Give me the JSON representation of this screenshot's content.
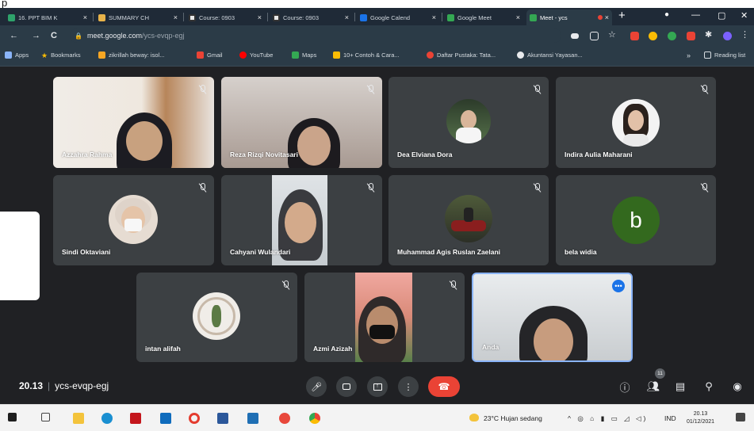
{
  "stray_char": "p",
  "browser": {
    "tabs": [
      {
        "label": "16. PPT BIM K",
        "color": "#2ea36b"
      },
      {
        "label": "SUMMARY CH",
        "color": "#e8b34a"
      },
      {
        "label": "Course: 0903",
        "color": "#333"
      },
      {
        "label": "Course: 0903",
        "color": "#333"
      },
      {
        "label": "Google Calend",
        "color": "#1a73e8"
      },
      {
        "label": "Google Meet",
        "color": "#34a853"
      },
      {
        "label": "Meet - ycs",
        "color": "#34a853"
      }
    ],
    "tab_close": "×",
    "new_tab": "+",
    "window_controls": {
      "minimize": "—",
      "maximize": "▢",
      "close": "✕"
    },
    "nav": {
      "back": "←",
      "forward": "→",
      "reload": "C"
    },
    "url_host": "meet.google.com",
    "url_path": "/ycs-evqp-egj",
    "extension_colors": [
      "#e8eaed",
      "#e8eaed",
      "#e8eaed",
      "#ea4335",
      "#fbbc04",
      "#34a853",
      "#ea4335",
      "#e8eaed",
      "#7b61ff",
      "#e8eaed"
    ],
    "bookmarks": [
      {
        "label": "Apps",
        "color": "#8ab4f8"
      },
      {
        "label": "Bookmarks",
        "color": "#fbbc04"
      },
      {
        "label": "zikrillah beway: isol...",
        "color": "#f6a623"
      },
      {
        "label": "Gmail",
        "color": "#ea4335"
      },
      {
        "label": "YouTube",
        "color": "#ff0000"
      },
      {
        "label": "Maps",
        "color": "#34a853"
      },
      {
        "label": "10+ Contoh & Cara...",
        "color": "#fbbc04"
      },
      {
        "label": "Daftar Pustaka: Tata...",
        "color": "#ea4335"
      },
      {
        "label": "Akuntansi Yayasan...",
        "color": "#e8eaed"
      }
    ],
    "bookmarks_more": "»",
    "reading_list": "Reading list"
  },
  "participants": [
    {
      "name": "Azzahra Rahma",
      "kind": "video",
      "bg": "#8c7b6b"
    },
    {
      "name": "Reza Rizqi Novitasari",
      "kind": "video",
      "bg": "#9d8f87"
    },
    {
      "name": "Dea Elviana Dora",
      "kind": "photo",
      "bg": "#3c4043"
    },
    {
      "name": "Indira Aulia Maharani",
      "kind": "photo",
      "bg": "#3c4043"
    },
    {
      "name": "Sindi Oktaviani",
      "kind": "photo",
      "bg": "#3c4043"
    },
    {
      "name": "Cahyani Wulandari",
      "kind": "video",
      "bg": "#3c4043"
    },
    {
      "name": "Muhammad Agis Ruslan Zaelani",
      "kind": "photo",
      "bg": "#3c4043"
    },
    {
      "name": "bela widia",
      "kind": "letter",
      "letter": "b",
      "bg": "#3c4043"
    },
    {
      "name": "intan alifah",
      "kind": "photo",
      "bg": "#3c4043"
    },
    {
      "name": "Azmi Azizah",
      "kind": "video",
      "bg": "#3c4043"
    },
    {
      "name": "Anda",
      "kind": "self",
      "bg": "#cfd3d6"
    }
  ],
  "controls": {
    "time": "20.13",
    "meeting_code": "ycs-evqp-egj",
    "participant_count": "11"
  },
  "taskbar": {
    "weather": "23°C  Hujan sedang",
    "lang": "IND",
    "clock_time": "20.13",
    "clock_date": "01/12/2021"
  },
  "colors": {
    "stage_bg": "#202124",
    "tile_bg": "#3c4043",
    "end_call": "#ea4335",
    "active_speaker_border": "#8ab4f8"
  }
}
